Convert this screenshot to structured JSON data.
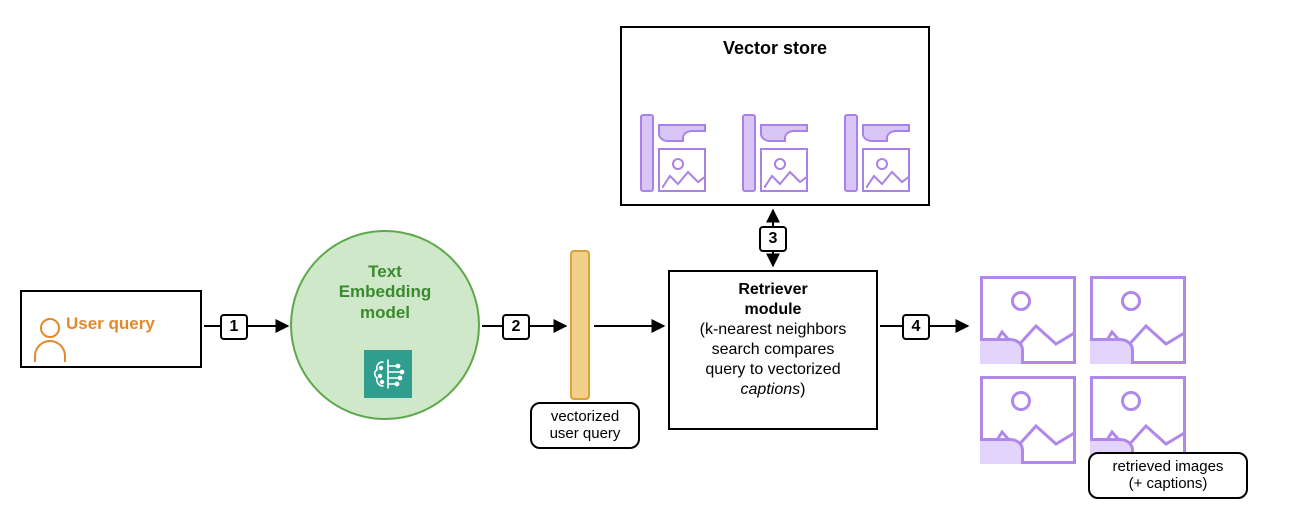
{
  "nodes": {
    "user_query": {
      "label": "User query"
    },
    "embedding_model": {
      "label_line1": "Text",
      "label_line2": "Embedding",
      "label_line3": "model"
    },
    "vectorized_query_caption": {
      "line1": "vectorized",
      "line2": "user query"
    },
    "retriever": {
      "title_line1": "Retriever",
      "title_line2": "module",
      "desc_line1": "(k-nearest neighbors",
      "desc_line2": "search compares",
      "desc_line3": "query to vectorized",
      "desc_line4_italic": "captions",
      "desc_line4_close": ")"
    },
    "vector_store": {
      "title": "Vector store"
    },
    "results_caption": {
      "line1": "retrieved images",
      "line2": "(+ captions)"
    }
  },
  "steps": {
    "s1": "1",
    "s2": "2",
    "s3": "3",
    "s4": "4"
  }
}
